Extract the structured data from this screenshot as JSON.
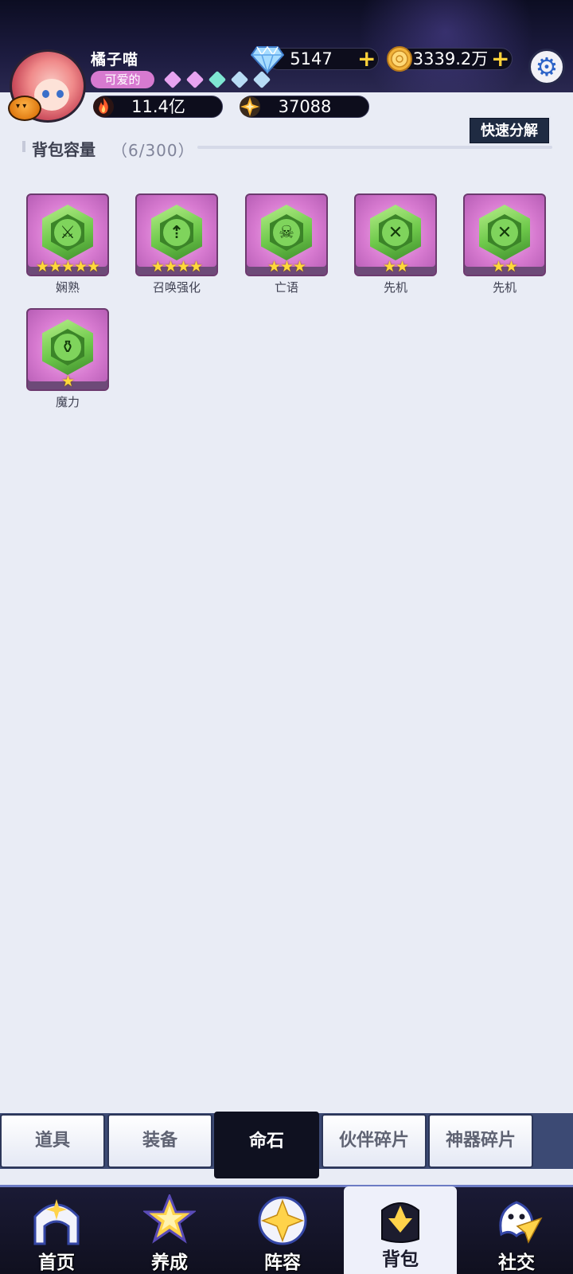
{
  "header": {
    "username": "橘子喵",
    "title_badge": "可爱的",
    "gem_colors": [
      "#e7a3f0",
      "#e7a3f0",
      "#7fe6d2",
      "#b8dcf5",
      "#b8dcf5"
    ],
    "power": "11.4亿",
    "stamina": "37088",
    "diamonds": "5147",
    "gold": "3339.2万",
    "icons": {
      "diamond": "diamond-icon",
      "gold": "gold-coin-icon",
      "power": "flame-icon",
      "stamina": "star-orb-icon",
      "settings": "gear-icon"
    }
  },
  "inventory": {
    "capacity_label": "背包容量",
    "capacity_count": "（6/300）",
    "quick_decompose": "快速分解",
    "items": [
      {
        "name": "娴熟",
        "stars": "★★★★★",
        "icon": "sword-icon"
      },
      {
        "name": "召唤强化",
        "stars": "★★★★",
        "icon": "summon-circle-icon"
      },
      {
        "name": "亡语",
        "stars": "★★★",
        "icon": "skull-icon"
      },
      {
        "name": "先机",
        "stars": "★★",
        "icon": "crossed-arrows-icon"
      },
      {
        "name": "先机",
        "stars": "★★",
        "icon": "crossed-arrows-icon"
      },
      {
        "name": "魔力",
        "stars": "★",
        "icon": "potion-icon"
      }
    ]
  },
  "tabs": [
    "道具",
    "装备",
    "命石",
    "伙伴碎片",
    "神器碎片"
  ],
  "active_tab": "命石",
  "nav": [
    {
      "label": "首页",
      "icon": "home-gate-icon"
    },
    {
      "label": "养成",
      "icon": "star-upgrade-icon"
    },
    {
      "label": "阵容",
      "icon": "formation-icon"
    },
    {
      "label": "背包",
      "icon": "backpack-icon"
    },
    {
      "label": "社交",
      "icon": "ghost-paper-plane-icon"
    }
  ],
  "active_nav": "背包"
}
